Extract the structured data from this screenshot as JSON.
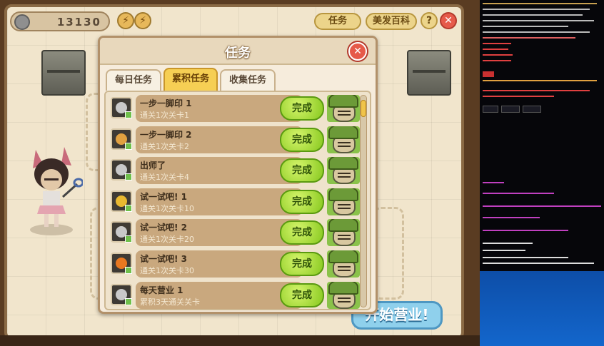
{
  "hud": {
    "coins": "13130",
    "bolt_1": "⚡",
    "bolt_2": "⚡",
    "btn_task": "任务",
    "btn_encyclopedia": "美发百科",
    "btn_help": "?",
    "btn_close": "✕"
  },
  "start_button": "开始营业!",
  "dialog": {
    "title": "任务",
    "close_glyph": "✕",
    "tabs": [
      {
        "label": "每日任务",
        "active": false
      },
      {
        "label": "累积任务",
        "active": true
      },
      {
        "label": "收集任务",
        "active": false
      }
    ],
    "tasks": [
      {
        "name": "一步一脚印 1",
        "desc": "通关1次关卡1",
        "button": "完成",
        "icon": "gear-icon",
        "icon_color": "#c8c8c8"
      },
      {
        "name": "一步一脚印 2",
        "desc": "通关1次关卡2",
        "button": "完成",
        "icon": "potion-icon",
        "icon_color": "#e0a040"
      },
      {
        "name": "出师了",
        "desc": "通关1次关卡4",
        "button": "完成",
        "icon": "gear-icon",
        "icon_color": "#c8c8c8"
      },
      {
        "name": "试一试吧! 1",
        "desc": "通关1次关卡10",
        "button": "完成",
        "icon": "coin-icon",
        "icon_color": "#e8b830"
      },
      {
        "name": "试一试吧! 2",
        "desc": "通关1次关卡20",
        "button": "完成",
        "icon": "gear-icon",
        "icon_color": "#c8c8c8"
      },
      {
        "name": "试一试吧! 3",
        "desc": "通关1次关卡30",
        "button": "完成",
        "icon": "fire-icon",
        "icon_color": "#e87820"
      },
      {
        "name": "每天营业 1",
        "desc": "累积3天通关关卡",
        "button": "完成",
        "icon": "gear-icon",
        "icon_color": "#c8c8c8"
      }
    ]
  },
  "colors": {
    "accent_yellow": "#f6cf54",
    "complete_green": "#86c81e",
    "close_red": "#e65a4a",
    "side_blue": "#1366cc"
  }
}
